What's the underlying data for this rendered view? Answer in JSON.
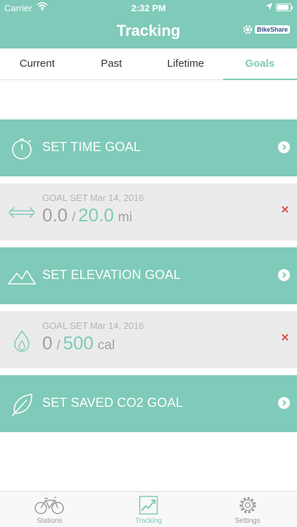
{
  "status_bar": {
    "carrier": "Carrier",
    "time": "2:32 PM",
    "battery_level": 0.9
  },
  "header": {
    "title": "Tracking",
    "logo_text": "BikeShare"
  },
  "tabs": [
    {
      "label": "Current",
      "active": false
    },
    {
      "label": "Past",
      "active": false
    },
    {
      "label": "Lifetime",
      "active": false
    },
    {
      "label": "Goals",
      "active": true
    }
  ],
  "goals": {
    "time": {
      "label": "SET TIME GOAL",
      "icon": "stopwatch-icon"
    },
    "distance": {
      "meta": "GOAL SET Mar 14, 2016",
      "current": "0.0",
      "separator": "/",
      "target": "20.0",
      "unit": "mi",
      "icon": "distance-arrows-icon"
    },
    "elevation": {
      "label": "SET ELEVATION GOAL",
      "icon": "mountain-icon"
    },
    "calories": {
      "meta": "GOAL SET Mar 14, 2016",
      "current": "0",
      "separator": "/",
      "target": "500",
      "unit": "cal",
      "icon": "flame-icon"
    },
    "co2": {
      "label": "SET SAVED CO2 GOAL",
      "icon": "leaf-icon"
    }
  },
  "tabbar": [
    {
      "label": "Stations",
      "icon": "bicycle-icon",
      "active": false
    },
    {
      "label": "Tracking",
      "icon": "chart-icon",
      "active": true
    },
    {
      "label": "Settings",
      "icon": "gear-icon",
      "active": false
    }
  ],
  "colors": {
    "accent": "#7fcab8",
    "set_goal_bg": "#ebebeb",
    "remove": "#d9534f",
    "logo": "#2f4f88"
  }
}
